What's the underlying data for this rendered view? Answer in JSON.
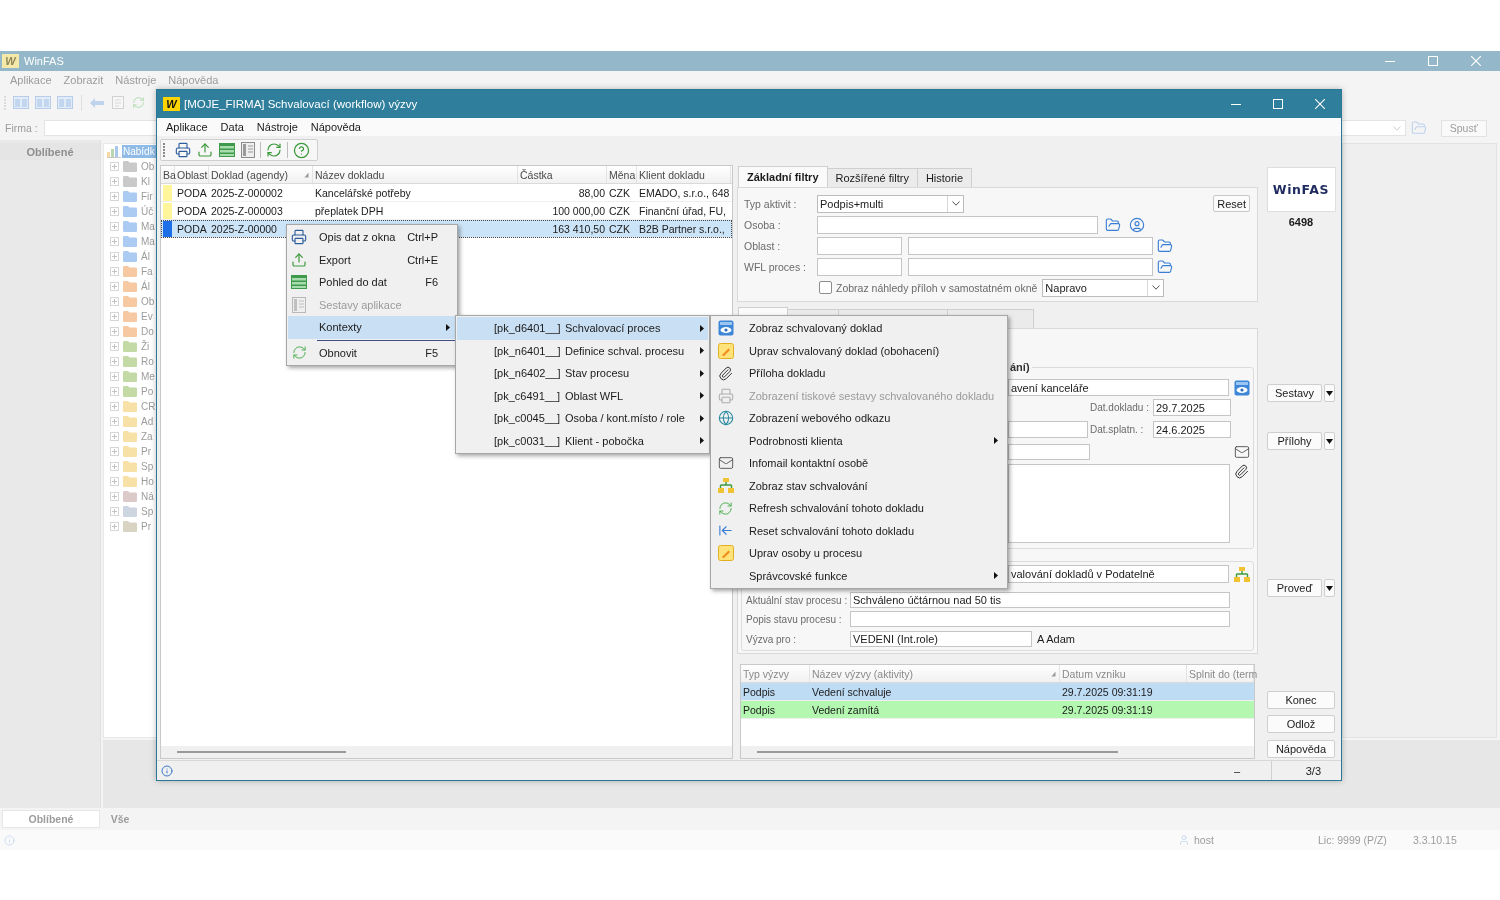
{
  "background_window": {
    "logo": "W",
    "title": "WinFAS",
    "menu": [
      "Aplikace",
      "Zobrazit",
      "Nástroje",
      "Nápověda"
    ],
    "company_label": "Firma :",
    "run_button": "Spusť",
    "favorites_header": "Oblíbené",
    "tree": [
      {
        "kind": "root",
        "label": "Nabídk",
        "selected": true
      },
      {
        "kind": "folder",
        "label": "Ob",
        "selected": false,
        "color": "#c9c9c9"
      },
      {
        "kind": "folder",
        "label": "Kl",
        "selected": false,
        "color": "#c9c9c9"
      },
      {
        "kind": "folder",
        "label": "Fir",
        "selected": false,
        "color": "#accbf3"
      },
      {
        "kind": "folder",
        "label": "Úč",
        "selected": false,
        "color": "#accbf3"
      },
      {
        "kind": "folder",
        "label": "Ma",
        "selected": false,
        "color": "#accbf3"
      },
      {
        "kind": "folder",
        "label": "Ma",
        "selected": false,
        "color": "#accbf3"
      },
      {
        "kind": "folder",
        "label": "Ál",
        "selected": false,
        "color": "#accbf3"
      },
      {
        "kind": "folder",
        "label": "Fa",
        "selected": false,
        "color": "#f6c9a2"
      },
      {
        "kind": "folder",
        "label": "Ál",
        "selected": false,
        "color": "#f6c9a2"
      },
      {
        "kind": "folder",
        "label": "Ob",
        "selected": false,
        "color": "#f6c9a2"
      },
      {
        "kind": "folder",
        "label": "Ev",
        "selected": false,
        "color": "#f6c9a2"
      },
      {
        "kind": "folder",
        "label": "Do",
        "selected": false,
        "color": "#f6c9a2"
      },
      {
        "kind": "folder",
        "label": "Ži",
        "selected": false,
        "color": "#c3d9a6"
      },
      {
        "kind": "folder",
        "label": "Ro",
        "selected": false,
        "color": "#c3d9a6"
      },
      {
        "kind": "folder",
        "label": "Me",
        "selected": false,
        "color": "#c3d9a6"
      },
      {
        "kind": "folder",
        "label": "Po",
        "selected": false,
        "color": "#c3d9a6"
      },
      {
        "kind": "folder",
        "label": "CR",
        "selected": false,
        "color": "#f7e1a6"
      },
      {
        "kind": "folder",
        "label": "Ad",
        "selected": false,
        "color": "#f7e1a6"
      },
      {
        "kind": "folder",
        "label": "Za",
        "selected": false,
        "color": "#f7e1a6"
      },
      {
        "kind": "folder",
        "label": "Pr",
        "selected": false,
        "color": "#f7e1a6"
      },
      {
        "kind": "folder",
        "label": "Sp",
        "selected": false,
        "color": "#f7e1a6"
      },
      {
        "kind": "folder",
        "label": "Ho",
        "selected": false,
        "color": "#f7e1a6"
      },
      {
        "kind": "folder",
        "label": "Ná",
        "selected": false,
        "color": "#dcc9c9"
      },
      {
        "kind": "folder",
        "label": "Sp",
        "selected": false,
        "color": "#cdd5e0"
      },
      {
        "kind": "folder",
        "label": "Pr",
        "selected": false,
        "color": "#d9d3c3"
      }
    ],
    "bottom_tabs": [
      {
        "label": "Oblíbené",
        "selected": true
      },
      {
        "label": "Vše",
        "selected": false
      }
    ],
    "status_bar": {
      "user": "host",
      "license": "Lic: 9999 (P/Z)",
      "version": "3.3.10.15"
    }
  },
  "dialog": {
    "logo": "W",
    "title": "[MOJE_FIRMA] Schvalovací (workflow) výzvy",
    "menu": [
      "Aplikace",
      "Data",
      "Nástroje",
      "Nápověda"
    ],
    "documents": {
      "columns": [
        {
          "label": "Ba",
          "sorted": false
        },
        {
          "label": "Oblast",
          "sorted": false
        },
        {
          "label": "Doklad (agendy)",
          "sorted": true
        },
        {
          "label": "Název dokladu",
          "sorted": false
        },
        {
          "label": "Částka",
          "sorted": false
        },
        {
          "label": "Měna",
          "sorted": false
        },
        {
          "label": "Klient dokladu",
          "sorted": false
        }
      ],
      "rows": [
        {
          "color": "#fff59a",
          "selected": false,
          "area": "PODA",
          "document": "2025-Z-000002",
          "name": "Kancelářské potřeby",
          "amount": "88,00",
          "currency": "CZK",
          "client": "EMADO, s.r.o., 648"
        },
        {
          "color": "#fff59a",
          "selected": false,
          "area": "PODA",
          "document": "2025-Z-000003",
          "name": "přeplatek DPH",
          "amount": "100 000,00",
          "currency": "CZK",
          "client": "Finanční úřad, FU,"
        },
        {
          "color": "#1c6fe6",
          "selected": true,
          "area": "PODA",
          "document": "2025-Z-00000",
          "amount": "163 410,50",
          "currency": "CZK",
          "client": "B2B Partner s.r.o.,"
        }
      ]
    },
    "filter_tabs": [
      {
        "label": "Základní filtry",
        "selected": true
      },
      {
        "label": "Rozšířené filtry",
        "selected": false
      },
      {
        "label": "Historie",
        "selected": false
      }
    ],
    "filters": {
      "activity_type": {
        "label": "Typ aktivit :",
        "value": "Podpis+multi"
      },
      "reset_button": "Reset",
      "person_label": "Osoba :",
      "area_label": "Oblast :",
      "process_label": "WFL proces :",
      "preview": {
        "label": "Zobraz náhledy příloh v samostatném okně",
        "checked": false,
        "position": "Napravo"
      }
    },
    "document_tabs": [
      {
        "selected": true
      },
      {
        "selected": false
      },
      {
        "selected": false
      },
      {
        "selected": false
      }
    ],
    "document": {
      "group_title": "ání)",
      "name": "avení kanceláře",
      "date_label": "Dat.dokladu :",
      "date": "29.7.2025",
      "due_label": "Dat.splatn. :",
      "due": "24.6.2025"
    },
    "process": {
      "name": "valování dokladů v Podatelně",
      "state_label": "Aktuální stav procesu :",
      "state": "Schváleno účtárnou nad 50 tis",
      "description_label": "Popis stavu procesu :",
      "assignee_label": "Výzva pro :",
      "assignee": "VEDENI (Int.role)",
      "assignee_person": "A Adam"
    },
    "calls": {
      "columns": [
        {
          "label": "Typ výzvy",
          "sorted": false
        },
        {
          "label": "Název výzvy (aktivity)",
          "sorted": true
        },
        {
          "label": "Datum vzniku",
          "sorted": false
        },
        {
          "label": "Splnit do (term",
          "sorted": false
        }
      ],
      "rows": [
        {
          "selected": true,
          "type": "Podpis",
          "name": "Vedení schvaluje",
          "created": "29.7.2025 09:31:19"
        },
        {
          "selected": false,
          "color": "#b3f7b0",
          "type": "Podpis",
          "name": "Vedení zamítá",
          "created": "29.7.2025 09:31:19"
        }
      ]
    },
    "brand_logo": "WinFAS",
    "record_count": "6498",
    "side_buttons": [
      {
        "label": "Sestavy",
        "dropdown": true
      },
      {
        "label": "Přílohy",
        "dropdown": true
      },
      {
        "label": "Proveď",
        "dropdown": true
      },
      {
        "label": "Konec",
        "dropdown": false
      },
      {
        "label": "Odlož",
        "dropdown": false
      },
      {
        "label": "Nápověda",
        "dropdown": false
      }
    ],
    "status_bar": {
      "mode": "–",
      "position": "3/3"
    }
  },
  "context_menu": {
    "items": [
      {
        "label": "Opis dat z okna",
        "shortcut": "Ctrl+P",
        "disabled": false,
        "selected": false,
        "submenu": false,
        "separator_before": false
      },
      {
        "label": "Export",
        "shortcut": "Ctrl+E",
        "disabled": false,
        "selected": false,
        "submenu": false,
        "separator_before": false
      },
      {
        "label": "Pohled do dat",
        "shortcut": "F6",
        "disabled": false,
        "selected": false,
        "submenu": false,
        "separator_before": false
      },
      {
        "label": "Sestavy aplikace",
        "disabled": true,
        "selected": false,
        "submenu": false,
        "separator_before": false
      },
      {
        "label": "Kontexty",
        "disabled": false,
        "selected": true,
        "submenu": true,
        "separator_before": false
      },
      {
        "label": "Obnovit",
        "shortcut": "F5",
        "disabled": false,
        "selected": false,
        "submenu": false,
        "separator_before": true
      }
    ]
  },
  "contexts_submenu": {
    "items": [
      {
        "code": "[pk_d6401__]",
        "label": "Schvalovací proces",
        "selected": true,
        "submenu": true
      },
      {
        "code": "[pk_n6401__]",
        "label": "Definice schval. procesu",
        "selected": false,
        "submenu": true
      },
      {
        "code": "[pk_n6402__]",
        "label": "Stav procesu",
        "selected": false,
        "submenu": true
      },
      {
        "code": "[pk_c6491__]",
        "label": "Oblast WFL",
        "selected": false,
        "submenu": true
      },
      {
        "code": "[pk_c0045__]",
        "label": "Osoba / kont.místo / role",
        "selected": false,
        "submenu": true
      },
      {
        "code": "[pk_c0031__]",
        "label": "Klient - pobočka",
        "selected": false,
        "submenu": true
      }
    ]
  },
  "process_submenu": {
    "items": [
      {
        "label": "Zobraz schvalovaný doklad",
        "disabled": false,
        "selected": false,
        "submenu": false
      },
      {
        "label": "Uprav schvalovaný doklad (obohacení)",
        "disabled": false,
        "selected": false,
        "submenu": false
      },
      {
        "label": "Příloha dokladu",
        "disabled": false,
        "selected": false,
        "submenu": false
      },
      {
        "label": "Zobrazení tiskové sestavy schvalovaného dokladu",
        "disabled": true,
        "selected": false,
        "submenu": false
      },
      {
        "label": "Zobrazení webového odkazu",
        "disabled": false,
        "selected": false,
        "submenu": false
      },
      {
        "label": "Podrobnosti klienta",
        "disabled": false,
        "selected": false,
        "submenu": true
      },
      {
        "label": "Infomail kontaktní osobě",
        "disabled": false,
        "selected": false,
        "submenu": false
      },
      {
        "label": "Zobraz stav schvalování",
        "disabled": false,
        "selected": false,
        "submenu": false
      },
      {
        "label": "Refresh schvalování tohoto dokladu",
        "disabled": false,
        "selected": false,
        "submenu": false
      },
      {
        "label": "Reset schvalování tohoto dokladu",
        "disabled": false,
        "selected": false,
        "submenu": false
      },
      {
        "label": "Uprav osoby u procesu",
        "disabled": false,
        "selected": false,
        "submenu": false
      },
      {
        "label": "Správcovské funkce",
        "disabled": false,
        "selected": false,
        "submenu": true
      }
    ]
  }
}
